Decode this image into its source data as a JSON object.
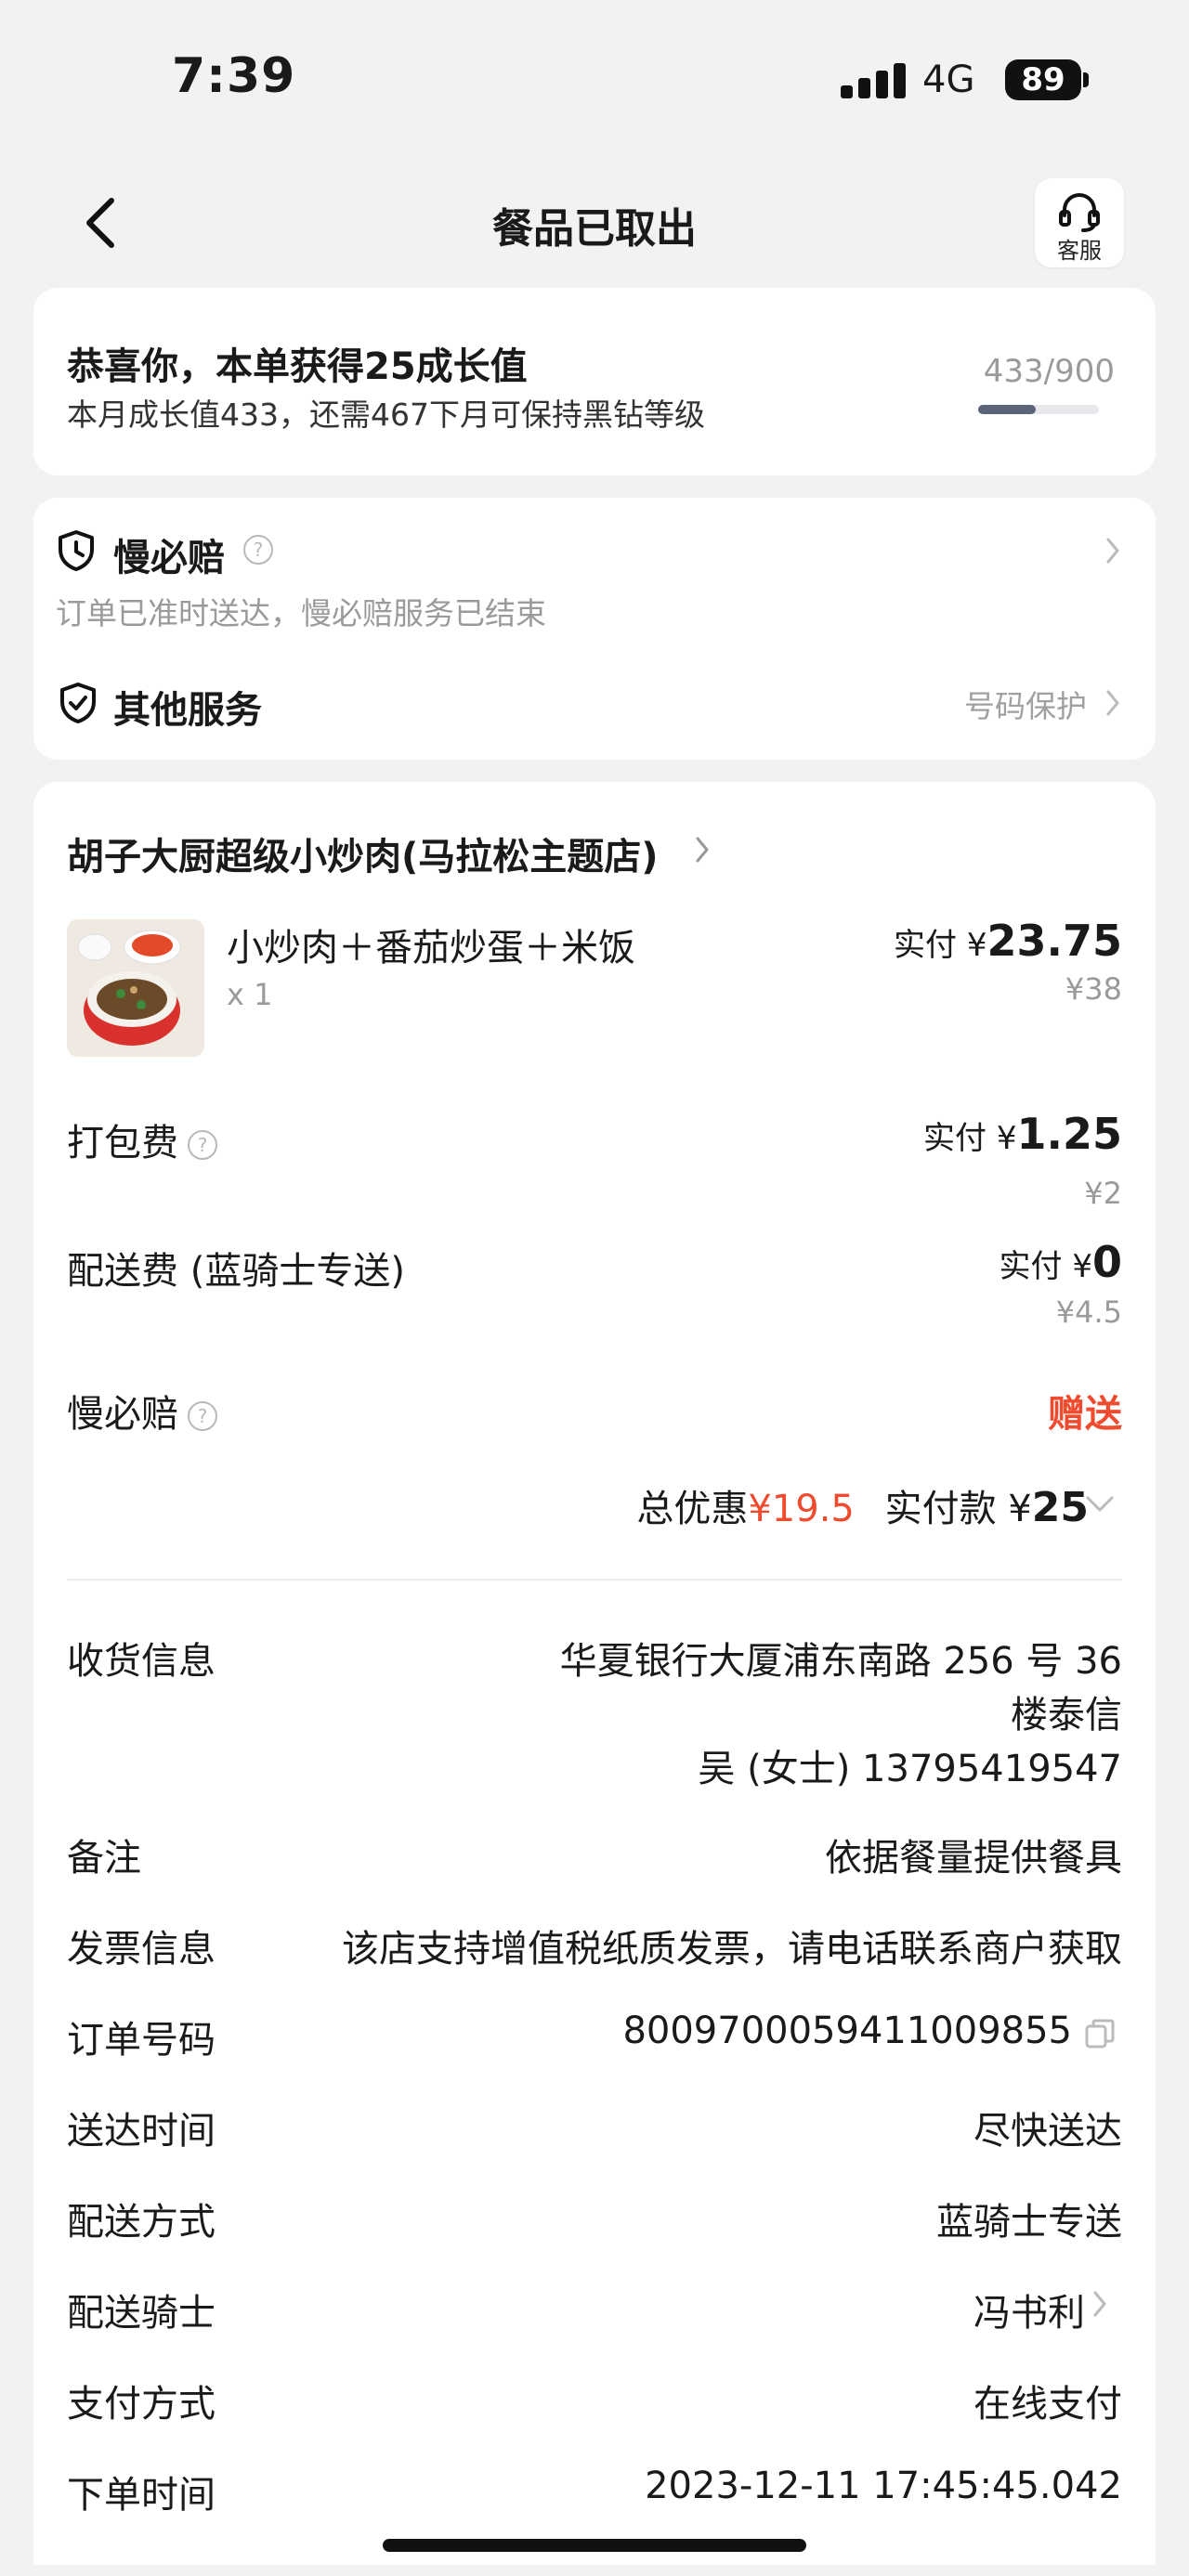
{
  "status_bar": {
    "time": "7:39",
    "network": "4G",
    "battery": "89"
  },
  "nav": {
    "title": "餐品已取出",
    "service_label": "客服"
  },
  "growth": {
    "title": "恭喜你，本单获得25成长值",
    "subtitle": "本月成长值433，还需467下月可保持黑钻等级",
    "count": "433/900",
    "progress_fraction": 0.48
  },
  "services": {
    "slow_pay": {
      "title": "慢必赔",
      "desc": "订单已准时送达，慢必赔服务已结束"
    },
    "other": {
      "title": "其他服务",
      "value": "号码保护"
    }
  },
  "order": {
    "store_name": "胡子大厨超级小炒肉(马拉松主题店)",
    "item": {
      "name": "小炒肉＋番茄炒蛋＋米饭",
      "qty": "x 1",
      "paid_label": "实付 ¥",
      "paid": "23.75",
      "original": "¥38"
    },
    "packing": {
      "label": "打包费",
      "paid_label": "实付 ¥",
      "paid": "1.25",
      "original": "¥2"
    },
    "delivery": {
      "label": "配送费 (蓝骑士专送)",
      "paid_label": "实付 ¥",
      "paid": "0",
      "original": "¥4.5"
    },
    "slow_pay": {
      "label": "慢必赔",
      "value": "赠送"
    },
    "total": {
      "discount_label": "总优惠",
      "discount": "¥19.5",
      "paid_label": "实付款 ¥",
      "paid": "25"
    }
  },
  "info": {
    "address_label": "收货信息",
    "address_line1": "华夏银行大厦浦东南路 256 号 36",
    "address_line2": "楼泰信",
    "address_contact": "吴 (女士) 13795419547",
    "note_label": "备注",
    "note": "依据餐量提供餐具",
    "invoice_label": "发票信息",
    "invoice": "该店支持增值税纸质发票，请电话联系商户获取",
    "order_no_label": "订单号码",
    "order_no": "8009700059411009855",
    "delivery_time_label": "送达时间",
    "delivery_time": "尽快送达",
    "delivery_method_label": "配送方式",
    "delivery_method": "蓝骑士专送",
    "rider_label": "配送骑士",
    "rider": "冯书利",
    "payment_label": "支付方式",
    "payment": "在线支付",
    "order_time_label": "下单时间",
    "order_time": "2023-12-11 17:45:45.042"
  },
  "colors": {
    "accent_red": "#ef4b2f",
    "background": "#f2f2f4",
    "progress": "#5a6478"
  },
  "icons": [
    "back-chevron-icon",
    "headset-icon",
    "clock-shield-icon",
    "check-shield-icon",
    "question-icon",
    "chevron-right-icon",
    "copy-icon",
    "cellular-signal-icon",
    "battery-icon"
  ]
}
